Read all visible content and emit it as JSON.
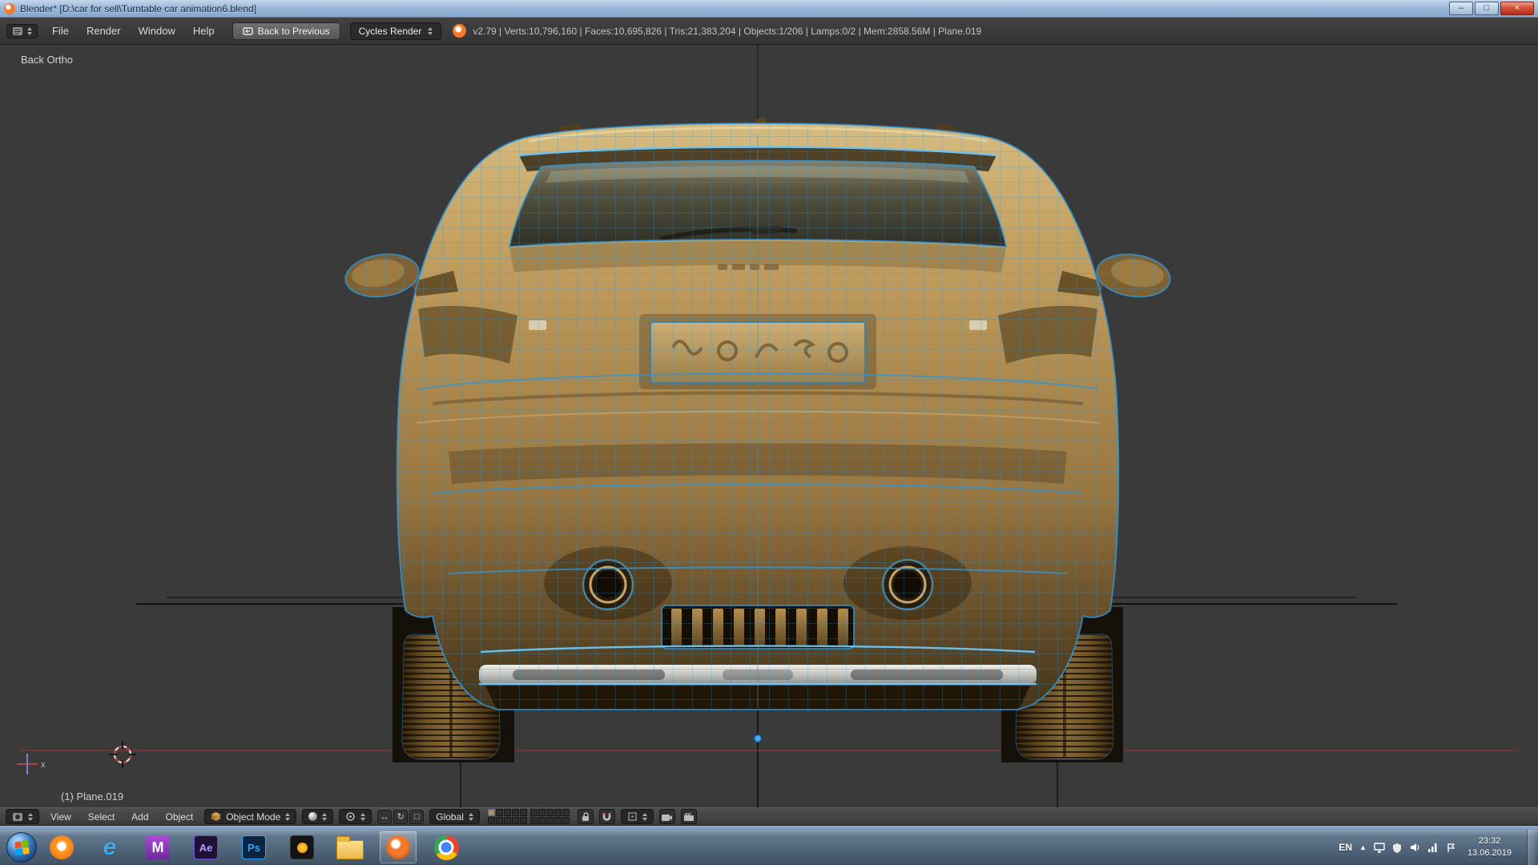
{
  "colors": {
    "blender_orange": "#f5792a",
    "wireframe_blue": "#2f96d8",
    "body_gold": "#ab874c",
    "viewport_bg": "#3a3a3a",
    "taskbar_blue": "#5c7084",
    "axis_red": "#7d3535"
  },
  "titlebar": {
    "title": "Blender* [D:\\car for sell\\Turntable car animation6.blend]",
    "minimize": "–",
    "maximize": "□",
    "close": "×"
  },
  "infobar": {
    "menus": [
      "File",
      "Render",
      "Window",
      "Help"
    ],
    "back_to_previous": "Back to Previous",
    "render_engine": "Cycles Render",
    "stats": "v2.79 | Verts:10,796,160 | Faces:10,695,826 | Tris:21,383,204 | Objects:1/206 | Lamps:0/2 | Mem:2858.56M | Plane.019"
  },
  "viewport": {
    "view_label": "Back Ortho",
    "active_object": "(1) Plane.019"
  },
  "viewport_header": {
    "menus": [
      "View",
      "Select",
      "Add",
      "Object"
    ],
    "mode": "Object Mode",
    "orientation": "Global"
  },
  "icons": {
    "translate": "↔",
    "rotate": "↻",
    "scale": "□",
    "hidden_icons": "▲"
  },
  "taskbar": {
    "language": "EN",
    "time": "23:32",
    "date": "13.06.2019"
  }
}
